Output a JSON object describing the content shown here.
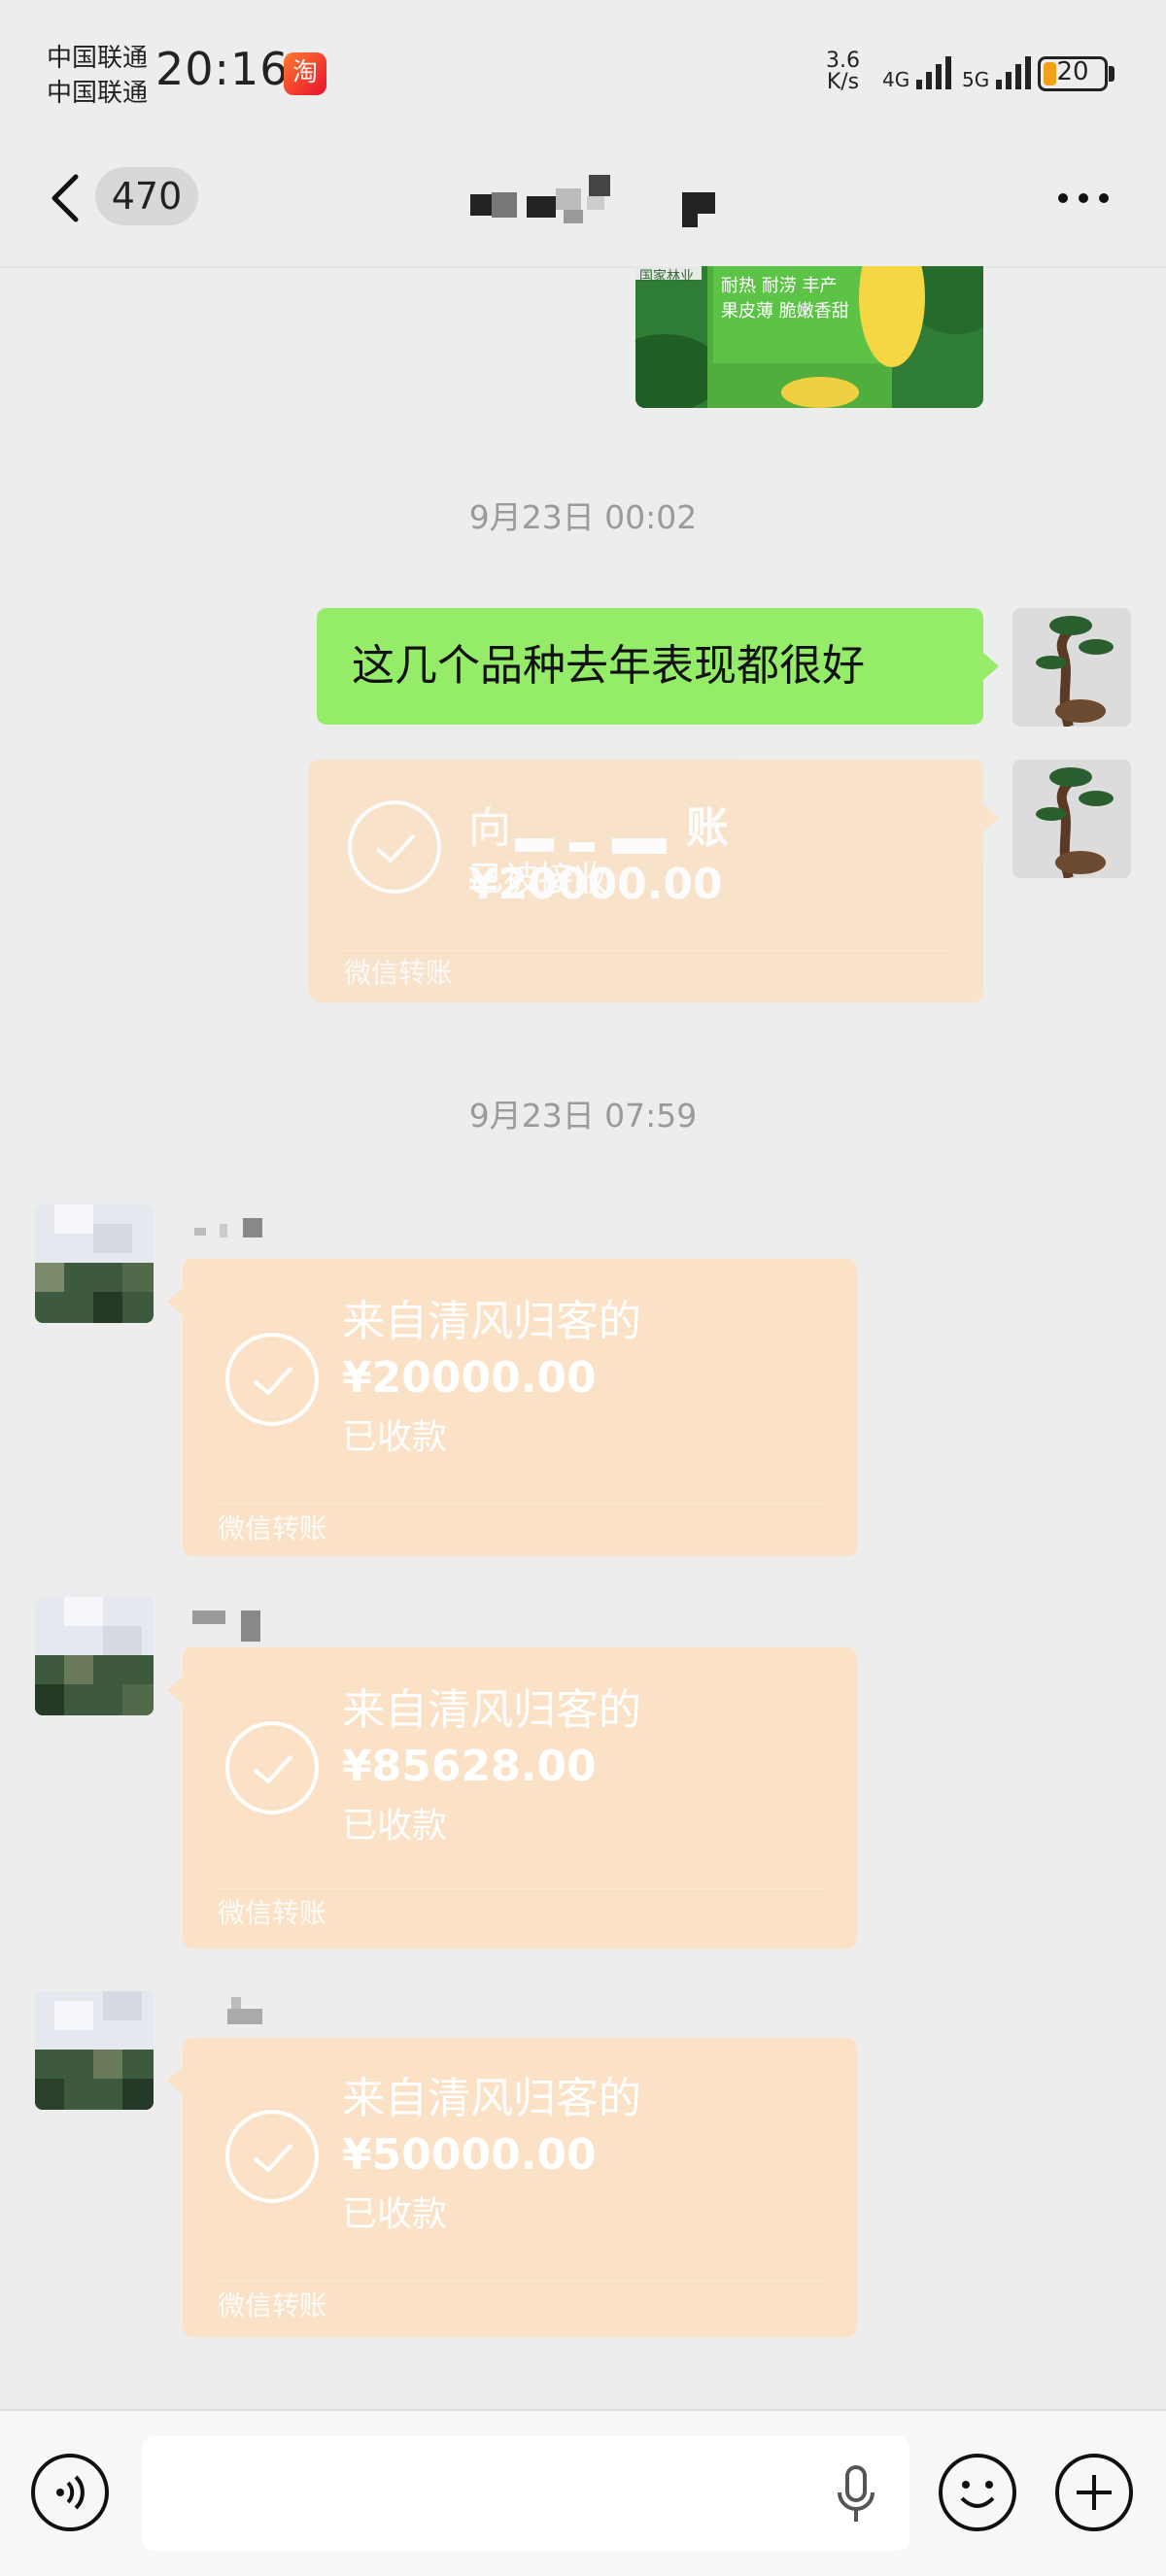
{
  "status_bar": {
    "carrier_1": "中国联通",
    "carrier_2": "中国联通",
    "time": "20:16",
    "app_badge": "淘",
    "net_speed_value": "3.6",
    "net_speed_unit": "K/s",
    "signal_1_label": "4G",
    "signal_2_label": "5G",
    "battery_level": "20"
  },
  "nav": {
    "unread_count": "470",
    "title_pixelated": true
  },
  "messages": {
    "image_message": {
      "caption_line1": "耐热 耐涝 丰产",
      "caption_line2": "果皮薄 脆嫩香甜",
      "brand_label": "国家林业"
    },
    "timestamp_1": "9月23日 00:02",
    "text_message": "这几个品种去年表现都很好",
    "outgoing_transfer": {
      "title": "向",
      "title_suffix": "账¥20000.00",
      "status": "已被接收",
      "footer": "微信转账"
    },
    "timestamp_2": "9月23日 07:59",
    "incoming_transfers": [
      {
        "title": "来自清风归客的",
        "amount": "¥20000.00",
        "status": "已收款",
        "footer": "微信转账"
      },
      {
        "title": "来自清风归客的",
        "amount": "¥85628.00",
        "status": "已收款",
        "footer": "微信转账"
      },
      {
        "title": "来自清风归客的",
        "amount": "¥50000.00",
        "status": "已收款",
        "footer": "微信转账"
      }
    ]
  },
  "input_bar": {
    "input_value": "",
    "input_placeholder": ""
  },
  "colors": {
    "chat_bg": "#ededed",
    "sent_bubble": "#95ec69",
    "transfer_card": "#fbe1c5",
    "battery_fill": "#f0a21a"
  }
}
